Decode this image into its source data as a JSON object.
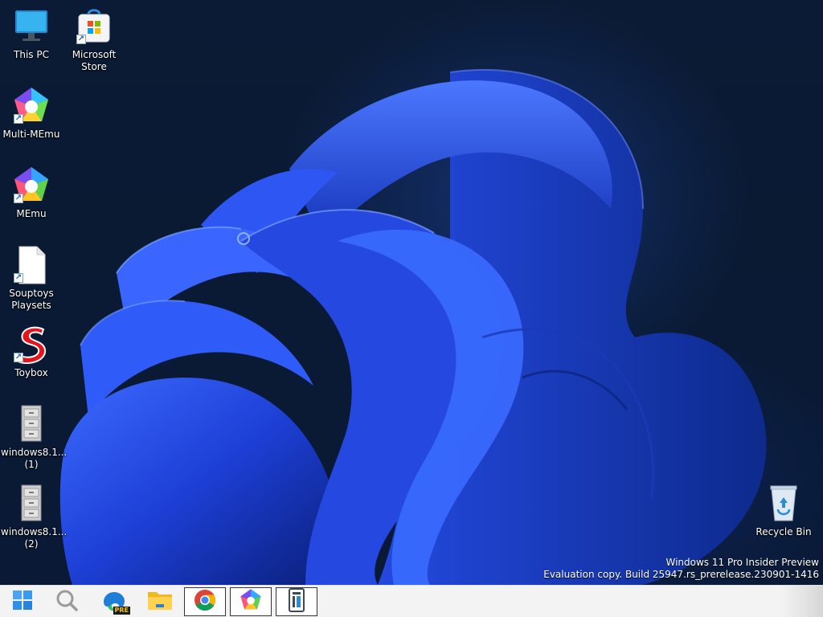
{
  "desktop": {
    "icons": [
      {
        "label": "This PC",
        "icon": "computer-icon"
      },
      {
        "label": "Microsoft Store",
        "icon": "store-icon"
      },
      {
        "label": "Multi-MEmu",
        "icon": "multi-memu-icon"
      },
      {
        "label": "MEmu",
        "icon": "memu-icon"
      },
      {
        "label": "Souptoys Playsets",
        "icon": "document-icon"
      },
      {
        "label": "Toybox",
        "icon": "toybox-icon"
      },
      {
        "label": "windows8.1... (1)",
        "icon": "file-cabinet-icon"
      },
      {
        "label": "windows8.1... (2)",
        "icon": "file-cabinet-icon"
      },
      {
        "label": "Recycle Bin",
        "icon": "recycle-bin-icon"
      }
    ]
  },
  "watermark": {
    "line1": "Windows 11 Pro Insider Preview",
    "line2": "Evaluation copy. Build 25947.rs_prerelease.230901-1416"
  },
  "taskbar": {
    "items": [
      {
        "name": "start",
        "icon": "windows-start-icon"
      },
      {
        "name": "search",
        "icon": "search-icon"
      },
      {
        "name": "edge-preview",
        "icon": "edge-pre-icon",
        "badge": "PRE"
      },
      {
        "name": "file-explorer",
        "icon": "folder-icon"
      },
      {
        "name": "chrome",
        "icon": "chrome-icon"
      },
      {
        "name": "memu",
        "icon": "memu-icon"
      },
      {
        "name": "app",
        "icon": "phone-app-icon"
      }
    ]
  },
  "colors": {
    "desktop_bg": "#0a1a33",
    "bloom_blue": "#2f57f0",
    "taskbar_bg": "#f3f3f3"
  }
}
